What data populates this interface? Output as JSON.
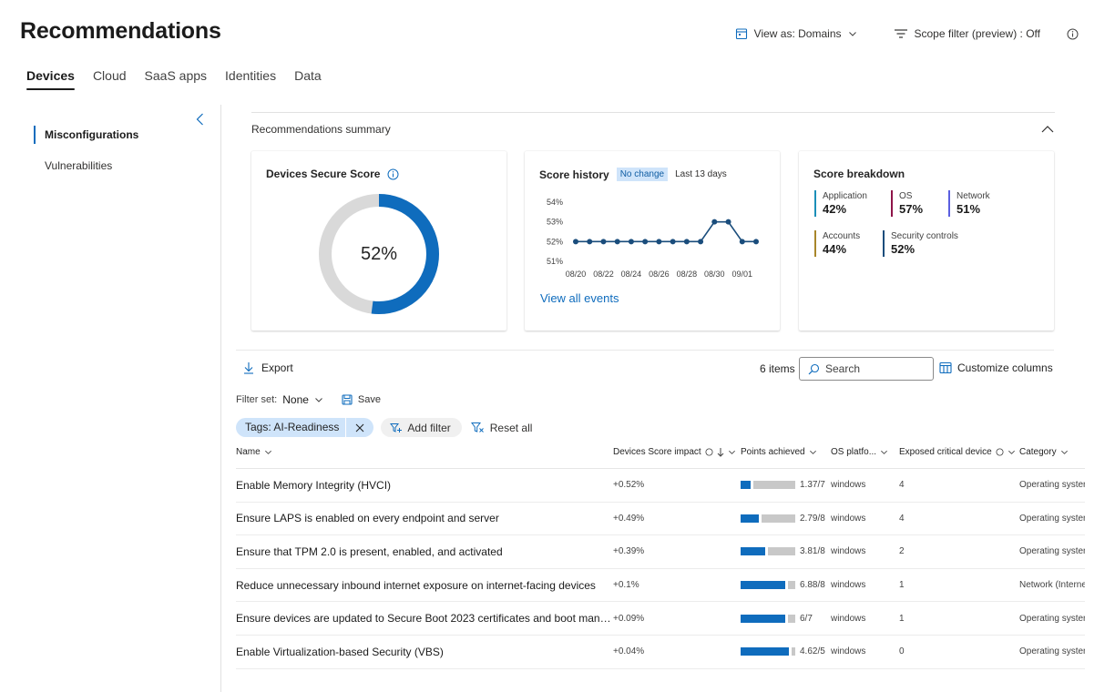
{
  "page": {
    "title": "Recommendations",
    "view_as": "View as: Domains",
    "scope_filter": "Scope filter (preview) : Off"
  },
  "tabs": [
    {
      "label": "Devices",
      "active": true
    },
    {
      "label": "Cloud"
    },
    {
      "label": "SaaS apps"
    },
    {
      "label": "Identities"
    },
    {
      "label": "Data"
    }
  ],
  "sidebar": {
    "items": [
      {
        "label": "Misconfigurations",
        "active": true
      },
      {
        "label": "Vulnerabilities"
      }
    ]
  },
  "summary": {
    "title": "Recommendations summary",
    "secure_score": {
      "title": "Devices Secure Score",
      "value": "52%",
      "fraction": 0.52
    },
    "score_history": {
      "title": "Score history",
      "badge": "No change",
      "period": "Last 13 days",
      "link": "View all events",
      "chart_data": {
        "type": "line",
        "y_ticks": [
          "54%",
          "53%",
          "52%",
          "51%"
        ],
        "ylim": [
          51,
          54
        ],
        "x_ticks": [
          "08/20",
          "08/22",
          "08/24",
          "08/26",
          "08/28",
          "08/30",
          "09/01"
        ],
        "values": [
          52,
          52,
          52,
          52,
          52,
          52,
          52,
          52,
          52,
          52,
          53,
          53,
          52,
          52
        ],
        "color": "#1a4d7c"
      }
    },
    "breakdown": {
      "title": "Score breakdown",
      "items": [
        {
          "label": "Application",
          "value": "42%",
          "color": "#1b8fb8"
        },
        {
          "label": "OS",
          "value": "57%",
          "color": "#8e1448"
        },
        {
          "label": "Network",
          "value": "51%",
          "color": "#5b5fe0"
        },
        {
          "label": "Accounts",
          "value": "44%",
          "color": "#a8862a"
        },
        {
          "label": "Security controls",
          "value": "52%",
          "color": "#1a4d7c"
        }
      ]
    }
  },
  "toolbar": {
    "export": "Export",
    "items_count": "6 items",
    "search_placeholder": "Search",
    "customize": "Customize columns"
  },
  "filters": {
    "filter_set_label": "Filter set:",
    "filter_set_value": "None",
    "save": "Save",
    "tag": "Tags: AI-Readiness",
    "add_filter": "Add filter",
    "reset_all": "Reset all"
  },
  "table": {
    "columns": {
      "name": "Name",
      "impact": "Devices Score impact",
      "points": "Points achieved",
      "os": "OS platfo...",
      "exposed": "Exposed critical device",
      "category": "Category"
    },
    "rows": [
      {
        "name": "Enable Memory Integrity (HVCI)",
        "impact": "+0.52%",
        "points": "1.37/7",
        "fraction": 0.196,
        "os": "windows",
        "exposed": "4",
        "category": "Operating syster"
      },
      {
        "name": "Ensure LAPS is enabled on every endpoint and server",
        "impact": "+0.49%",
        "points": "2.79/8",
        "fraction": 0.349,
        "os": "windows",
        "exposed": "4",
        "category": "Operating syster"
      },
      {
        "name": "Ensure that TPM 2.0 is present, enabled, and activated",
        "impact": "+0.39%",
        "points": "3.81/8",
        "fraction": 0.476,
        "os": "windows",
        "exposed": "2",
        "category": "Operating syster"
      },
      {
        "name": "Reduce unnecessary inbound internet exposure on internet-facing devices",
        "impact": "+0.1%",
        "points": "6.88/8",
        "fraction": 0.86,
        "os": "windows",
        "exposed": "1",
        "category": "Network (Interne"
      },
      {
        "name": "Ensure devices are updated to Secure Boot 2023 certificates and boot mana...",
        "impact": "+0.09%",
        "points": "6/7",
        "fraction": 0.857,
        "os": "windows",
        "exposed": "1",
        "category": "Operating syster"
      },
      {
        "name": "Enable Virtualization-based Security (VBS)",
        "impact": "+0.04%",
        "points": "4.62/5",
        "fraction": 0.924,
        "os": "windows",
        "exposed": "0",
        "category": "Operating syster"
      }
    ]
  }
}
